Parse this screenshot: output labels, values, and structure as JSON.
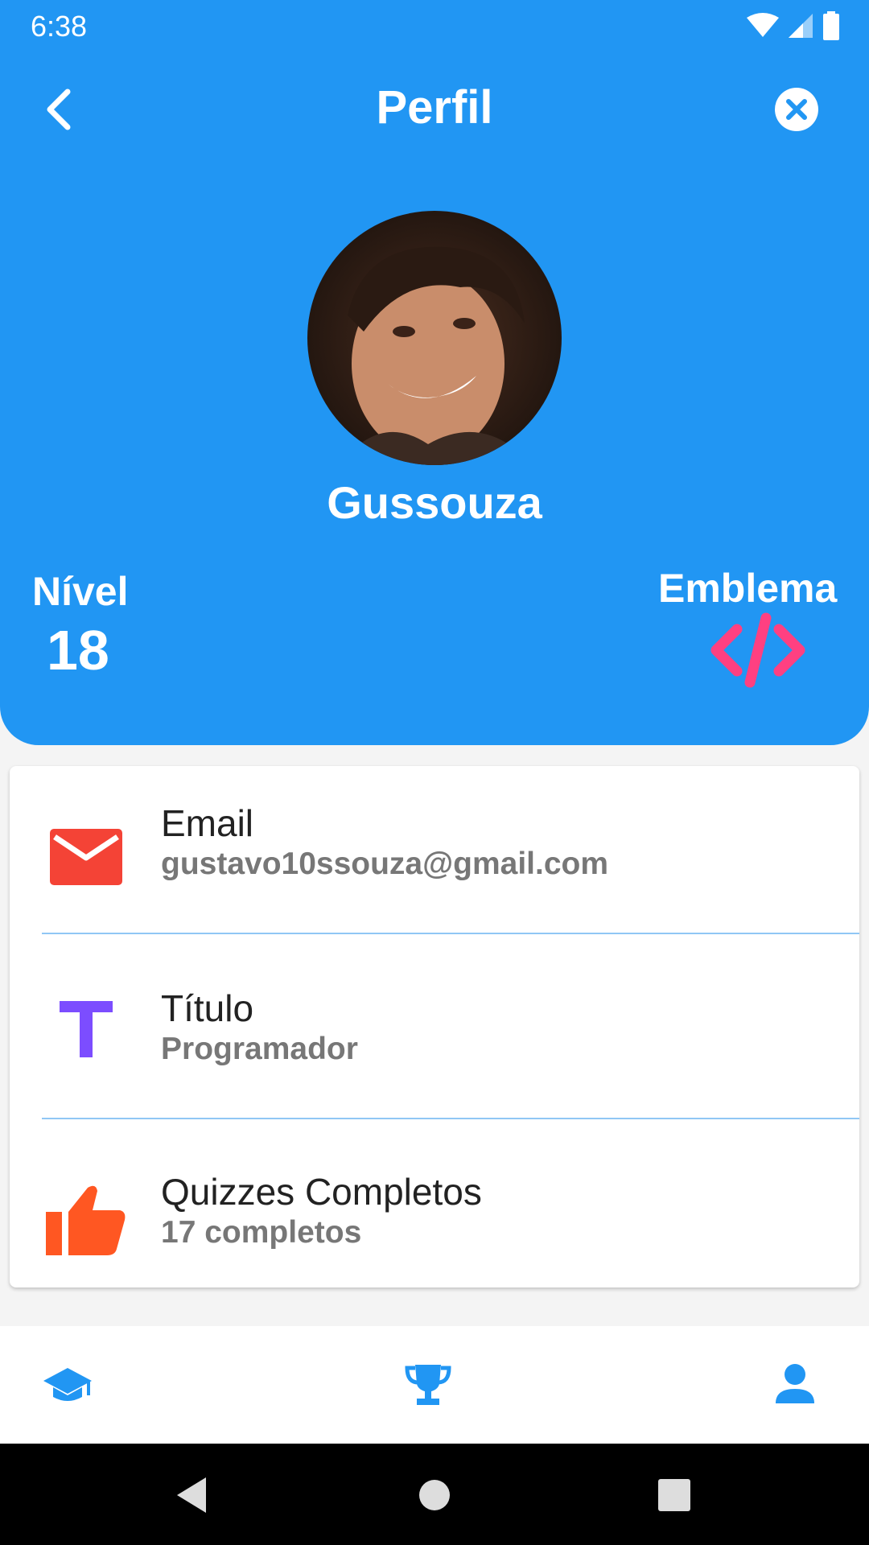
{
  "status_bar": {
    "time": "6:38"
  },
  "app_bar": {
    "title": "Perfil"
  },
  "profile": {
    "username": "Gussouza",
    "level_label": "Nível",
    "level_value": "18",
    "badge_label": "Emblema",
    "badge_icon": "code-icon"
  },
  "info": [
    {
      "title": "Email",
      "subtitle": "gustavo10ssouza@gmail.com",
      "icon": "mail-icon",
      "color": "#f44336"
    },
    {
      "title": "Título",
      "subtitle": "Programador",
      "icon": "title-t-icon",
      "color": "#7c4dff"
    },
    {
      "title": "Quizzes Completos",
      "subtitle": "17 completos",
      "icon": "thumb-up-icon",
      "color": "#ff5722"
    }
  ],
  "bottom_nav": [
    {
      "icon": "graduation-cap-icon"
    },
    {
      "icon": "trophy-icon"
    },
    {
      "icon": "person-icon"
    }
  ],
  "colors": {
    "primary": "#2196f3",
    "badge": "#ff4081",
    "divider": "#90c7f5"
  }
}
